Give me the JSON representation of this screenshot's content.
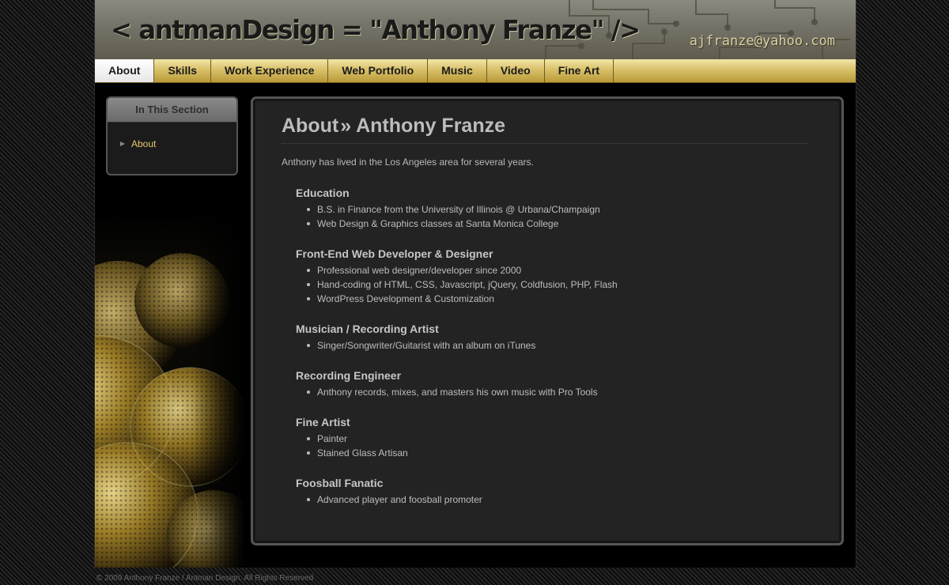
{
  "header": {
    "site_title": "< antmanDesign  = \"Anthony Franze\" />",
    "email": "ajfranze@yahoo.com"
  },
  "nav": {
    "tabs": [
      {
        "label": "About",
        "active": true
      },
      {
        "label": "Skills",
        "active": false
      },
      {
        "label": "Work Experience",
        "active": false
      },
      {
        "label": "Web Portfolio",
        "active": false
      },
      {
        "label": "Music",
        "active": false
      },
      {
        "label": "Video",
        "active": false
      },
      {
        "label": "Fine Art",
        "active": false
      }
    ]
  },
  "sidebar": {
    "heading": "In This Section",
    "items": [
      {
        "label": "About"
      }
    ]
  },
  "main": {
    "breadcrumb_parent": "About",
    "breadcrumb_separator": "»",
    "title": "Anthony Franze",
    "intro": "Anthony has lived in the Los Angeles area for several years.",
    "sections": [
      {
        "heading": "Education",
        "items": [
          "B.S. in Finance from the University of Illinois @ Urbana/Champaign",
          "Web Design & Graphics classes at Santa Monica College"
        ]
      },
      {
        "heading": "Front-End Web Developer & Designer",
        "items": [
          "Professional web designer/developer since 2000",
          "Hand-coding of HTML, CSS, Javascript, jQuery, Coldfusion, PHP, Flash",
          "WordPress Development & Customization"
        ]
      },
      {
        "heading": "Musician / Recording Artist",
        "items": [
          "Singer/Songwriter/Guitarist with an album on iTunes"
        ]
      },
      {
        "heading": "Recording Engineer",
        "items": [
          "Anthony records, mixes, and masters his own music with Pro Tools"
        ]
      },
      {
        "heading": "Fine Artist",
        "items": [
          "Painter",
          "Stained Glass Artisan"
        ]
      },
      {
        "heading": "Foosball Fanatic",
        "items": [
          "Advanced player and foosball promoter"
        ]
      }
    ]
  },
  "footer": {
    "copyright": "© 2009 Anthony Franze / Antman Design. All Rights Reserved"
  },
  "colors": {
    "accent_gold": "#d9c06a",
    "sidebar_link": "#e3c96d",
    "content_bg": "#232323"
  }
}
